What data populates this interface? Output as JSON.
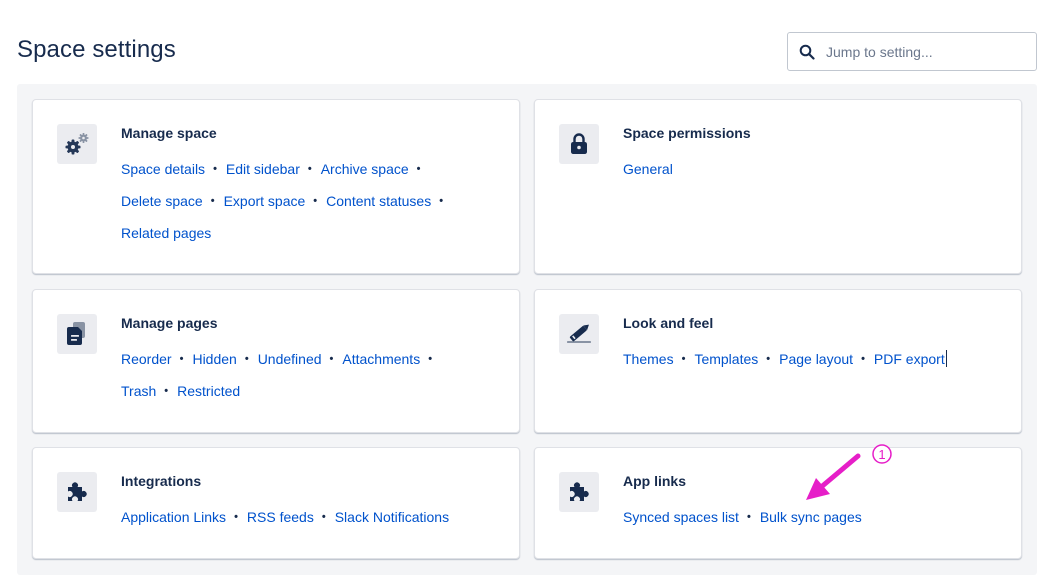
{
  "page": {
    "title": "Space settings"
  },
  "search": {
    "placeholder": "Jump to setting...",
    "icon": "search-icon"
  },
  "cards": {
    "manage_space": {
      "title": "Manage space",
      "icon": "gears-icon",
      "links": [
        "Space details",
        "Edit sidebar",
        "Archive space",
        "Delete space",
        "Export space",
        "Content statuses",
        "Related pages"
      ]
    },
    "space_permissions": {
      "title": "Space permissions",
      "icon": "lock-icon",
      "links": [
        "General"
      ]
    },
    "manage_pages": {
      "title": "Manage pages",
      "icon": "documents-icon",
      "links": [
        "Reorder",
        "Hidden",
        "Undefined",
        "Attachments",
        "Trash",
        "Restricted"
      ]
    },
    "look_and_feel": {
      "title": "Look and feel",
      "icon": "pencil-icon",
      "links": [
        "Themes",
        "Templates",
        "Page layout",
        "PDF export"
      ]
    },
    "integrations": {
      "title": "Integrations",
      "icon": "puzzle-icon",
      "links": [
        "Application Links",
        "RSS feeds",
        "Slack Notifications"
      ]
    },
    "app_links": {
      "title": "App links",
      "icon": "puzzle-icon",
      "links": [
        "Synced spaces list",
        "Bulk sync pages"
      ]
    }
  },
  "annotation": {
    "marker": "1",
    "color": "#e61ec8"
  },
  "colors": {
    "link": "#0052cc",
    "text": "#172b4d",
    "panel": "#f4f5f7"
  }
}
